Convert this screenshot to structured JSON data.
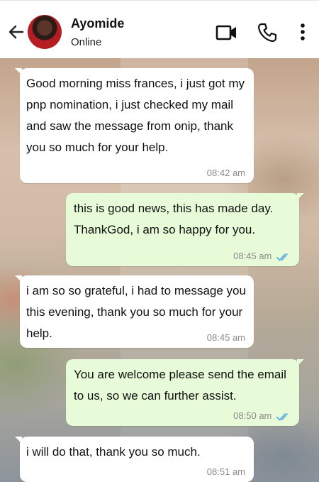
{
  "header": {
    "contact_name": "Ayomide",
    "status": "Online",
    "icons": {
      "back": "back-arrow-icon",
      "video": "video-call-icon",
      "call": "phone-icon",
      "menu": "more-options-icon"
    }
  },
  "messages": [
    {
      "direction": "incoming",
      "text": "Good morning miss frances, i just got my pnp nomination, i just checked my mail and saw the message from onip, thank you so much for your help.",
      "time": "08:42 am"
    },
    {
      "direction": "outgoing",
      "text": "this is good news, this has made day. ThankGod, i am so happy for you.",
      "time": "08:45 am",
      "read": true
    },
    {
      "direction": "incoming",
      "text": "i am so so grateful,  i had to message you this evening, thank you so much for your help.",
      "time": "08:45 am"
    },
    {
      "direction": "outgoing",
      "text": "You are welcome please send the email to us, so we can further assist.",
      "time": "08:50 am",
      "read": true
    },
    {
      "direction": "incoming",
      "text": "i will do that, thank you so much.",
      "time": "08:51 am"
    }
  ],
  "colors": {
    "incoming_bubble": "#ffffff",
    "outgoing_bubble": "#e7fbd8",
    "read_ticks": "#4aa8e8"
  }
}
